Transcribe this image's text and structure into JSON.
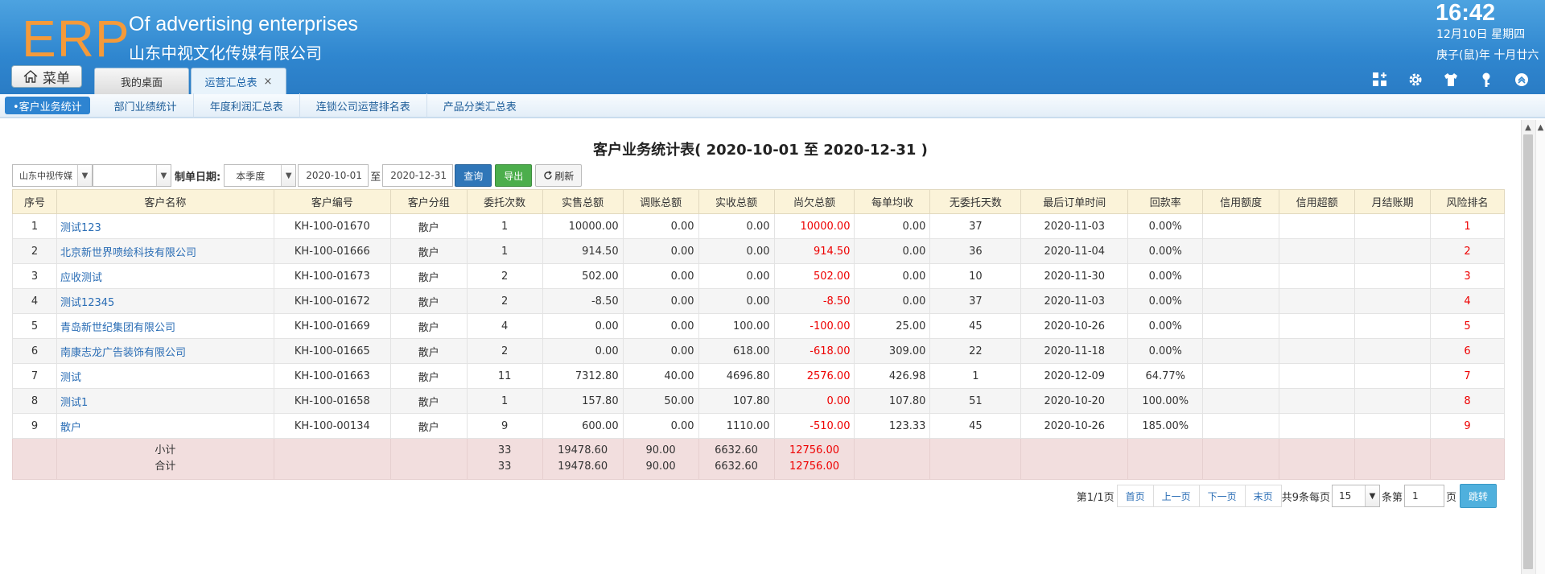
{
  "header": {
    "logo": "ERP",
    "company_en": "Of advertising enterprises",
    "company_cn": "山东中视文化传媒有限公司",
    "time": "16:42",
    "date": "12月10日 星期四",
    "lunar": "庚子(鼠)年 十月廿六",
    "menu_label": "菜单",
    "tabs": [
      {
        "label": "我的桌面"
      },
      {
        "label": "运营汇总表",
        "close": "×"
      }
    ]
  },
  "subnav": [
    "•客户业务统计",
    "部门业绩统计",
    "年度利润汇总表",
    "连锁公司运营排名表",
    "产品分类汇总表"
  ],
  "report": {
    "title": "客户业务统计表( 2020-10-01 至 2020-12-31 )"
  },
  "filters": {
    "company": "山东中视传媒",
    "dept": "",
    "date_label": "制单日期:",
    "period": "本季度",
    "start": "2020-10-01",
    "to": "至",
    "end": "2020-12-31",
    "query": "查询",
    "export": "导出",
    "refresh": "刷新"
  },
  "table": {
    "headers": [
      "序号",
      "客户名称",
      "客户编号",
      "客户分组",
      "委托次数",
      "实售总额",
      "调账总额",
      "实收总额",
      "尚欠总额",
      "每单均收",
      "无委托天数",
      "最后订单时间",
      "回款率",
      "信用额度",
      "信用超额",
      "月结账期",
      "风险排名"
    ],
    "rows": [
      [
        "1",
        "测试123",
        "KH-100-01670",
        "散户",
        "1",
        "10000.00",
        "0.00",
        "0.00",
        "10000.00",
        "0.00",
        "37",
        "2020-11-03",
        "0.00%",
        "",
        "",
        "",
        "1"
      ],
      [
        "2",
        "北京新世界喷绘科技有限公司",
        "KH-100-01666",
        "散户",
        "1",
        "914.50",
        "0.00",
        "0.00",
        "914.50",
        "0.00",
        "36",
        "2020-11-04",
        "0.00%",
        "",
        "",
        "",
        "2"
      ],
      [
        "3",
        "应收测试",
        "KH-100-01673",
        "散户",
        "2",
        "502.00",
        "0.00",
        "0.00",
        "502.00",
        "0.00",
        "10",
        "2020-11-30",
        "0.00%",
        "",
        "",
        "",
        "3"
      ],
      [
        "4",
        "测试12345",
        "KH-100-01672",
        "散户",
        "2",
        "-8.50",
        "0.00",
        "0.00",
        "-8.50",
        "0.00",
        "37",
        "2020-11-03",
        "0.00%",
        "",
        "",
        "",
        "4"
      ],
      [
        "5",
        "青岛新世纪集团有限公司",
        "KH-100-01669",
        "散户",
        "4",
        "0.00",
        "0.00",
        "100.00",
        "-100.00",
        "25.00",
        "45",
        "2020-10-26",
        "0.00%",
        "",
        "",
        "",
        "5"
      ],
      [
        "6",
        "南康志龙广告装饰有限公司",
        "KH-100-01665",
        "散户",
        "2",
        "0.00",
        "0.00",
        "618.00",
        "-618.00",
        "309.00",
        "22",
        "2020-11-18",
        "0.00%",
        "",
        "",
        "",
        "6"
      ],
      [
        "7",
        "测试",
        "KH-100-01663",
        "散户",
        "11",
        "7312.80",
        "40.00",
        "4696.80",
        "2576.00",
        "426.98",
        "1",
        "2020-12-09",
        "64.77%",
        "",
        "",
        "",
        "7"
      ],
      [
        "8",
        "测试1",
        "KH-100-01658",
        "散户",
        "1",
        "157.80",
        "50.00",
        "107.80",
        "0.00",
        "107.80",
        "51",
        "2020-10-20",
        "100.00%",
        "",
        "",
        "",
        "8"
      ],
      [
        "9",
        "散户",
        "KH-100-00134",
        "散户",
        "9",
        "600.00",
        "0.00",
        "1110.00",
        "-510.00",
        "123.33",
        "45",
        "2020-10-26",
        "185.00%",
        "",
        "",
        "",
        "9"
      ]
    ],
    "subtotal": {
      "label": "小计",
      "count": "33",
      "sales": "19478.60",
      "adjust": "90.00",
      "received": "6632.60",
      "owed": "12756.00"
    },
    "total": {
      "label": "合计",
      "count": "33",
      "sales": "19478.60",
      "adjust": "90.00",
      "received": "6632.60",
      "owed": "12756.00"
    }
  },
  "pager": {
    "page_info": "第1/1页",
    "first": "首页",
    "prev": "上一页",
    "next": "下一页",
    "last": "末页",
    "total_info": "共9条每页",
    "per_page": "15",
    "items_label": "条第",
    "page_input": "1",
    "page_label": "页",
    "go": "跳转"
  },
  "colors": {
    "header_blue": "#2f86cf",
    "logo_orange": "#f49a3a",
    "link_blue": "#2a6db5",
    "negative_red": "#e00000",
    "table_header_bg": "#fbf3d9",
    "sum_row_bg": "#f2dede"
  }
}
